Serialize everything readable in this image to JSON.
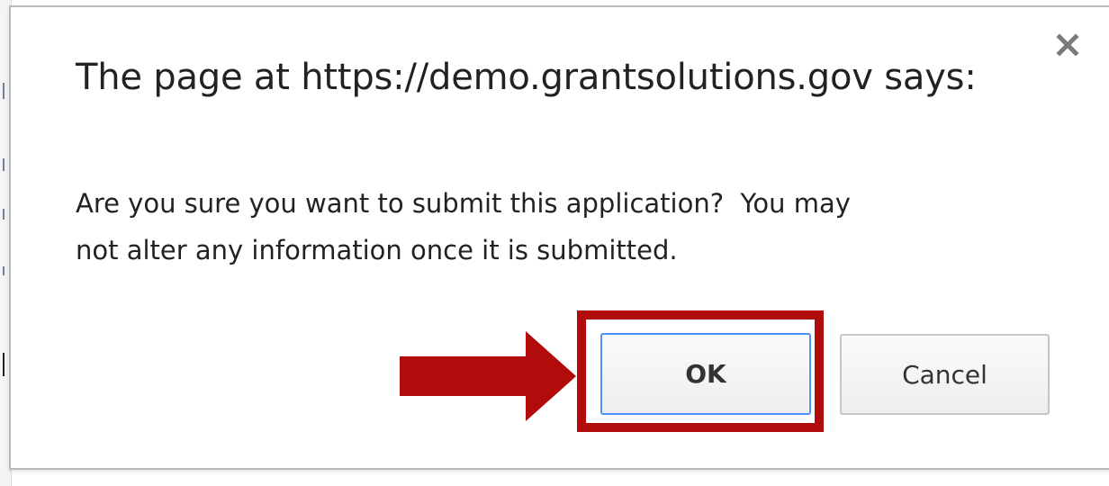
{
  "dialog": {
    "title": "The page at https://demo.grantsolutions.gov says:",
    "message": "Are you sure you want to submit this application?  You may\nnot alter any information once it is submitted.",
    "close_icon": "close-icon",
    "buttons": {
      "ok_label": "OK",
      "cancel_label": "Cancel"
    }
  },
  "annotation": {
    "highlight_color": "#b20b0b",
    "arrow_icon": "right-arrow-icon",
    "target": "ok-button"
  },
  "colors": {
    "ok_border": "#4d90fe",
    "button_border": "#c6c6c6",
    "text": "#222222"
  }
}
